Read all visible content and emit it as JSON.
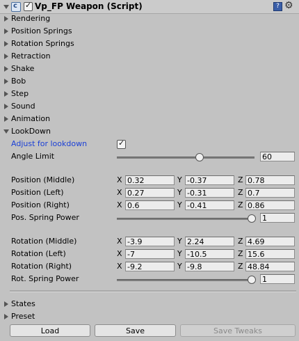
{
  "component": {
    "title": "Vp_FP Weapon (Script)",
    "enabled": true
  },
  "sections_top": [
    "Rendering",
    "Position Springs",
    "Rotation Springs",
    "Retraction",
    "Shake",
    "Bob",
    "Step",
    "Sound",
    "Animation"
  ],
  "lookdown": {
    "label": "LookDown",
    "adjust_label": "Adjust for lookdown",
    "adjust_checked": true,
    "angle_label": "Angle Limit",
    "angle_value": "60",
    "angle_fraction": 0.6,
    "vectors": [
      {
        "label": "Position (Middle)",
        "x": "0.32",
        "y": "-0.37",
        "z": "0.78"
      },
      {
        "label": "Position (Left)",
        "x": "0.27",
        "y": "-0.31",
        "z": "0.7"
      },
      {
        "label": "Position (Right)",
        "x": "0.6",
        "y": "-0.41",
        "z": "0.86"
      }
    ],
    "pos_power_label": "Pos. Spring Power",
    "pos_power_value": "1",
    "pos_power_fraction": 1.0,
    "rot_vectors": [
      {
        "label": "Rotation (Middle)",
        "x": "-3.9",
        "y": "2.24",
        "z": "4.69"
      },
      {
        "label": "Rotation (Left)",
        "x": "-7",
        "y": "-10.5",
        "z": "15.6"
      },
      {
        "label": "Rotation (Right)",
        "x": "-9.2",
        "y": "-9.8",
        "z": "48.84"
      }
    ],
    "rot_power_label": "Rot. Spring Power",
    "rot_power_value": "1",
    "rot_power_fraction": 1.0
  },
  "axis_labels": {
    "x": "X",
    "y": "Y",
    "z": "Z"
  },
  "sections_bottom": [
    "States",
    "Preset"
  ],
  "buttons": {
    "load": "Load",
    "save": "Save",
    "save_tweaks": "Save Tweaks"
  },
  "colors": {
    "accent_label": "#1a3fd6"
  }
}
